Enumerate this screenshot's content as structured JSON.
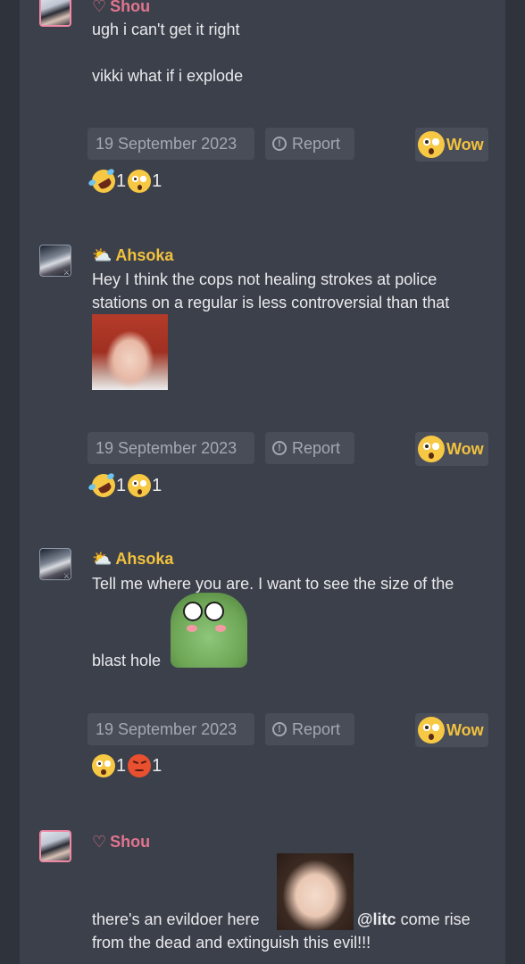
{
  "posts": [
    {
      "author": "Shou",
      "author_icon": "heart-outline-icon",
      "text_lines": [
        "ugh i can't get it right",
        "vikki what if i explode"
      ],
      "date": "19 September 2023",
      "report_label": "Report",
      "wow_label": "Wow",
      "reactions": [
        {
          "emoji": "rolling-on-floor-laughing",
          "count": "1"
        },
        {
          "emoji": "astonished",
          "count": "1"
        }
      ]
    },
    {
      "author": "Ahsoka",
      "author_icon": "sun-behind-cloud-icon",
      "text": "Hey I think the cops not healing strokes at police stations on a regular is less controversial than that",
      "date": "19 September 2023",
      "report_label": "Report",
      "wow_label": "Wow",
      "reactions": [
        {
          "emoji": "rolling-on-floor-laughing",
          "count": "1"
        },
        {
          "emoji": "astonished",
          "count": "1"
        }
      ]
    },
    {
      "author": "Ahsoka",
      "author_icon": "sun-behind-cloud-icon",
      "text_line1": "Tell me where you are. I want to see the size of the",
      "text_line2": "blast hole",
      "date": "19 September 2023",
      "report_label": "Report",
      "wow_label": "Wow",
      "reactions": [
        {
          "emoji": "astonished",
          "count": "1"
        },
        {
          "emoji": "angry",
          "count": "1"
        }
      ]
    },
    {
      "author": "Shou",
      "author_icon": "heart-outline-icon",
      "text_before": "there's an evildoer here",
      "mention": "@litc",
      "text_after_line1": "come rise",
      "text_after_line2": "from the dead and extinguish this evil!!!"
    }
  ],
  "colors": {
    "background": "#2f333c",
    "panel": "#3c404a",
    "button": "#484d58",
    "shou_name": "#e0758f",
    "ahsoka_name": "#f2c23e"
  }
}
